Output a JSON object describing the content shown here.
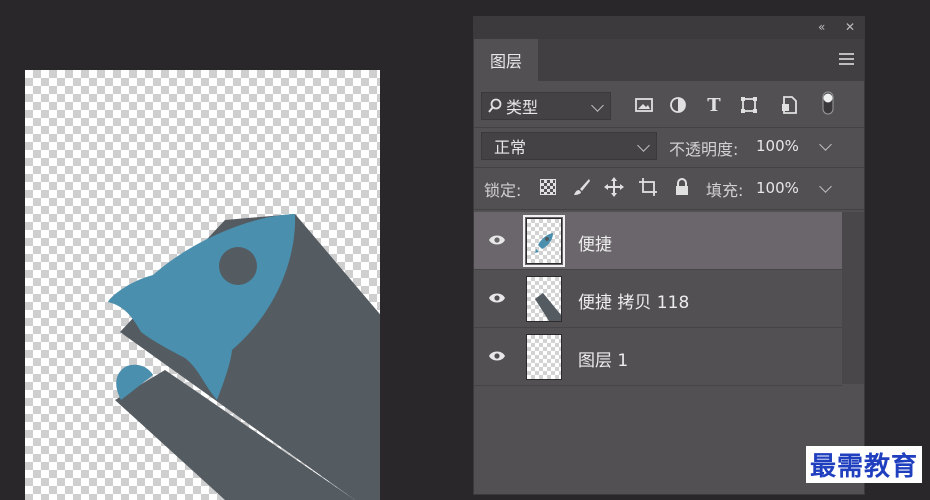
{
  "panel": {
    "collapse_glyph": "«",
    "close_glyph": "✕",
    "tab_label": "图层"
  },
  "filter": {
    "kind_label": "类型",
    "kind_icon": "search-icon",
    "filter_icons": [
      "image-icon",
      "adjustment-icon",
      "type-icon",
      "shape-icon",
      "smart-object-icon",
      "toggle-icon"
    ]
  },
  "blend": {
    "mode": "正常",
    "opacity_label": "不透明度:",
    "opacity_value": "100%"
  },
  "lock": {
    "label": "锁定:",
    "fill_label": "填充:",
    "fill_value": "100%"
  },
  "layers": [
    {
      "name": "便捷",
      "selected": true
    },
    {
      "name": "便捷 拷贝 118",
      "selected": false
    },
    {
      "name": "图层 1",
      "selected": false
    }
  ],
  "colors": {
    "rocket": "#4a8fae",
    "shadow": "#545b61",
    "panel": "#535054",
    "selected_layer": "#6a666b"
  },
  "watermark": "最需教育"
}
